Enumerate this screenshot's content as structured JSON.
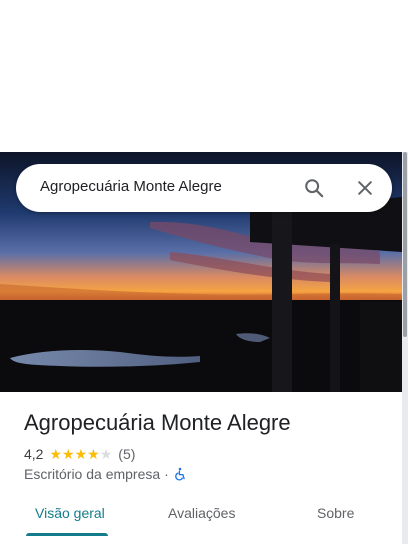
{
  "search": {
    "value": "Agropecuária Monte Alegre",
    "search_icon": "search-icon",
    "close_icon": "close-icon"
  },
  "hero": {
    "image": "sunset-over-farmland-photo"
  },
  "place": {
    "name": "Agropecuária Monte Alegre",
    "rating": "4,2",
    "stars_filled": 4,
    "stars_total": 5,
    "review_count": "(5)",
    "category": "Escritório da empresa",
    "separator": "·",
    "accessibility_icon": "wheelchair-icon"
  },
  "tabs": [
    {
      "label": "Visão geral",
      "active": true
    },
    {
      "label": "Avaliações",
      "active": false
    },
    {
      "label": "Sobre",
      "active": false
    }
  ],
  "colors": {
    "accent": "#137c8a",
    "star": "#fbbc04",
    "star_empty": "#dadce0",
    "accessibility": "#1a73e8"
  }
}
